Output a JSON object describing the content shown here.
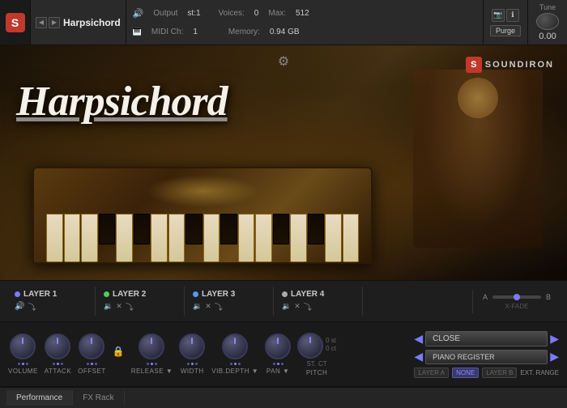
{
  "app": {
    "title": "Harpsichord",
    "logo": "S"
  },
  "topbar": {
    "output_label": "Output",
    "output_value": "st:1",
    "midi_label": "MIDI Ch:",
    "midi_value": "1",
    "voices_label": "Voices:",
    "voices_value": "0",
    "max_label": "Max:",
    "max_value": "512",
    "memory_label": "Memory:",
    "memory_value": "0.94 GB",
    "purge_label": "Purge",
    "tune_label": "Tune",
    "tune_value": "0.00"
  },
  "main_title": "Harpsichord",
  "brand": {
    "name": "SOUNDIRON",
    "logo": "S"
  },
  "layers": [
    {
      "name": "LAYER 1",
      "dot_color": "#7a7aff",
      "active": true
    },
    {
      "name": "LAYER 2",
      "dot_color": "#55cc55",
      "active": false
    },
    {
      "name": "LAYER 3",
      "dot_color": "#5599ff",
      "active": false
    },
    {
      "name": "LAYER 4",
      "dot_color": "#aaaaaa",
      "active": false
    }
  ],
  "xfade": {
    "a_label": "A",
    "b_label": "B",
    "label": "X-FADE"
  },
  "controls": [
    {
      "id": "volume",
      "label": "VOLUME"
    },
    {
      "id": "attack",
      "label": "ATTACK"
    },
    {
      "id": "offset",
      "label": "OFFSET"
    },
    {
      "id": "release",
      "label": "RELEASE ▼"
    },
    {
      "id": "width",
      "label": "WIDTH"
    },
    {
      "id": "vib_depth",
      "label": "VIB.DEPTH ▼"
    },
    {
      "id": "pan",
      "label": "PAN ▼"
    },
    {
      "id": "pitch",
      "label": "PITCH"
    }
  ],
  "pitch_values": {
    "semitone": "0 st",
    "cents": "0 ct"
  },
  "stereo_labels": {
    "st": "ST.",
    "ct": "CT"
  },
  "right_panel": {
    "close_label": "CLOSE",
    "piano_register_label": "PIANO REGISTER",
    "layer_a": "LAYER A",
    "none": "NONE",
    "layer_b": "LAYER B",
    "ext_range": "EXT. RANGE"
  },
  "bottom_tabs": [
    {
      "label": "Performance",
      "active": true
    },
    {
      "label": "FX Rack",
      "active": false
    }
  ]
}
